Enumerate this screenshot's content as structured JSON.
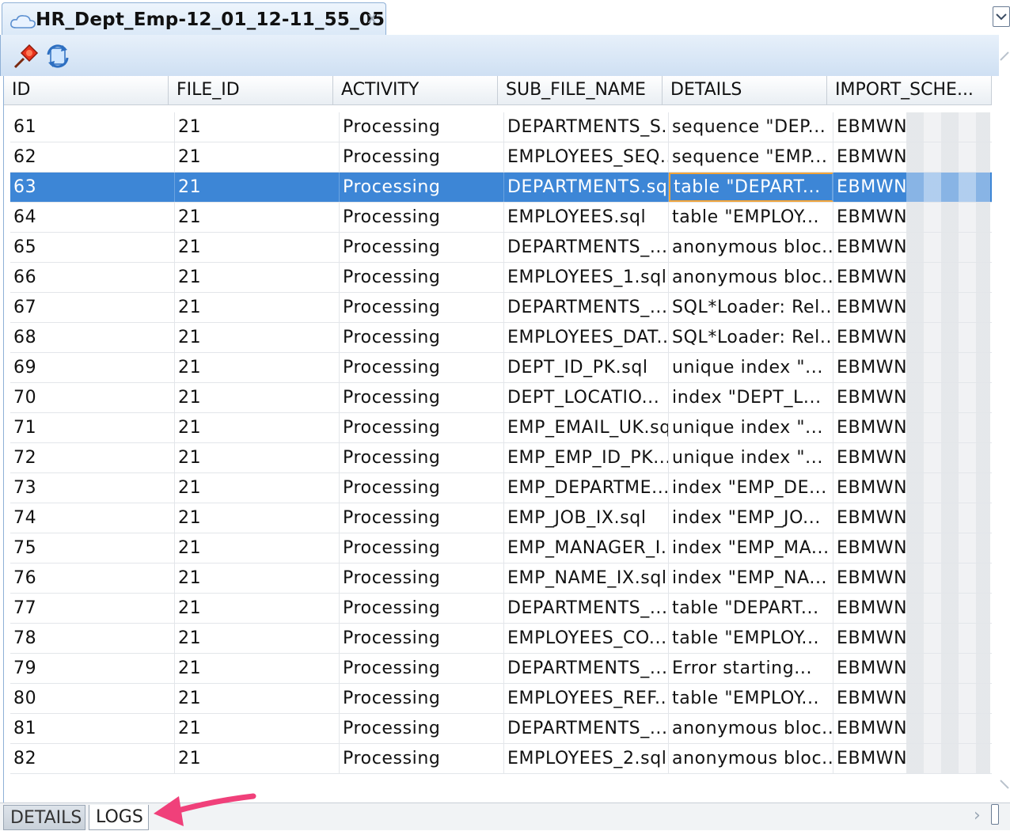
{
  "tab": {
    "title": "HR_Dept_Emp-12_01_12-11_55_05",
    "close": "x"
  },
  "columns": [
    "ID",
    "FILE_ID",
    "ACTIVITY",
    "SUB_FILE_NAME",
    "DETAILS",
    "IMPORT_SCHE..."
  ],
  "selected_row_index": 2,
  "rows": [
    {
      "id": "61",
      "file_id": "21",
      "activity": "Processing",
      "sub_file_name": "DEPARTMENTS_S...",
      "details": "sequence \"DEP...",
      "import_schema": "EBMWNI"
    },
    {
      "id": "62",
      "file_id": "21",
      "activity": "Processing",
      "sub_file_name": "EMPLOYEES_SEQ...",
      "details": "sequence \"EMP...",
      "import_schema": "EBMWNI"
    },
    {
      "id": "63",
      "file_id": "21",
      "activity": "Processing",
      "sub_file_name": "DEPARTMENTS.sql",
      "details": "table \"DEPART...",
      "import_schema": "EBMWNI"
    },
    {
      "id": "64",
      "file_id": "21",
      "activity": "Processing",
      "sub_file_name": "EMPLOYEES.sql",
      "details": "table \"EMPLOY...",
      "import_schema": "EBMWNI"
    },
    {
      "id": "65",
      "file_id": "21",
      "activity": "Processing",
      "sub_file_name": "DEPARTMENTS_...",
      "details": "anonymous bloc...",
      "import_schema": "EBMWNI"
    },
    {
      "id": "66",
      "file_id": "21",
      "activity": "Processing",
      "sub_file_name": "EMPLOYEES_1.sql",
      "details": "anonymous bloc...",
      "import_schema": "EBMWNI"
    },
    {
      "id": "67",
      "file_id": "21",
      "activity": "Processing",
      "sub_file_name": "DEPARTMENTS_...",
      "details": "SQL*Loader: Rel...",
      "import_schema": "EBMWNI"
    },
    {
      "id": "68",
      "file_id": "21",
      "activity": "Processing",
      "sub_file_name": "EMPLOYEES_DAT...",
      "details": "SQL*Loader: Rel...",
      "import_schema": "EBMWNI"
    },
    {
      "id": "69",
      "file_id": "21",
      "activity": "Processing",
      "sub_file_name": "DEPT_ID_PK.sql",
      "details": "unique index \"...",
      "import_schema": "EBMWNI"
    },
    {
      "id": "70",
      "file_id": "21",
      "activity": "Processing",
      "sub_file_name": "DEPT_LOCATIO...",
      "details": "index \"DEPT_L...",
      "import_schema": "EBMWNI"
    },
    {
      "id": "71",
      "file_id": "21",
      "activity": "Processing",
      "sub_file_name": "EMP_EMAIL_UK.sql",
      "details": "unique index \"...",
      "import_schema": "EBMWNI"
    },
    {
      "id": "72",
      "file_id": "21",
      "activity": "Processing",
      "sub_file_name": "EMP_EMP_ID_PK....",
      "details": "unique index \"...",
      "import_schema": "EBMWNI"
    },
    {
      "id": "73",
      "file_id": "21",
      "activity": "Processing",
      "sub_file_name": "EMP_DEPARTME...",
      "details": "index \"EMP_DE...",
      "import_schema": "EBMWNI"
    },
    {
      "id": "74",
      "file_id": "21",
      "activity": "Processing",
      "sub_file_name": "EMP_JOB_IX.sql",
      "details": "index \"EMP_JO...",
      "import_schema": "EBMWNI"
    },
    {
      "id": "75",
      "file_id": "21",
      "activity": "Processing",
      "sub_file_name": "EMP_MANAGER_I...",
      "details": "index \"EMP_MA...",
      "import_schema": "EBMWNI"
    },
    {
      "id": "76",
      "file_id": "21",
      "activity": "Processing",
      "sub_file_name": "EMP_NAME_IX.sql",
      "details": "index \"EMP_NA...",
      "import_schema": "EBMWNI"
    },
    {
      "id": "77",
      "file_id": "21",
      "activity": "Processing",
      "sub_file_name": "DEPARTMENTS_...",
      "details": "table \"DEPART...",
      "import_schema": "EBMWNI"
    },
    {
      "id": "78",
      "file_id": "21",
      "activity": "Processing",
      "sub_file_name": "EMPLOYEES_CO...",
      "details": "table \"EMPLOY...",
      "import_schema": "EBMWNI"
    },
    {
      "id": "79",
      "file_id": "21",
      "activity": "Processing",
      "sub_file_name": "DEPARTMENTS_...",
      "details": "Error starting...",
      "import_schema": "EBMWNI"
    },
    {
      "id": "80",
      "file_id": "21",
      "activity": "Processing",
      "sub_file_name": "EMPLOYEES_REF...",
      "details": "table \"EMPLOY...",
      "import_schema": "EBMWNI"
    },
    {
      "id": "81",
      "file_id": "21",
      "activity": "Processing",
      "sub_file_name": "DEPARTMENTS_...",
      "details": "anonymous bloc...",
      "import_schema": "EBMWNI"
    },
    {
      "id": "82",
      "file_id": "21",
      "activity": "Processing",
      "sub_file_name": "EMPLOYEES_2.sql",
      "details": "anonymous bloc...",
      "import_schema": "EBMWNI"
    }
  ],
  "bottom_tabs": [
    {
      "label": "DETAILS",
      "active": false
    },
    {
      "label": "LOGS",
      "active": true
    }
  ],
  "icons": {
    "tab": "cloud-icon",
    "toolbar": [
      "pin-icon",
      "refresh-icon"
    ],
    "annotation": "arrow-icon"
  },
  "colors": {
    "selection": "#3d86d6",
    "focus_border": "#f1a43a",
    "annotation_arrow": "#f0407a"
  }
}
